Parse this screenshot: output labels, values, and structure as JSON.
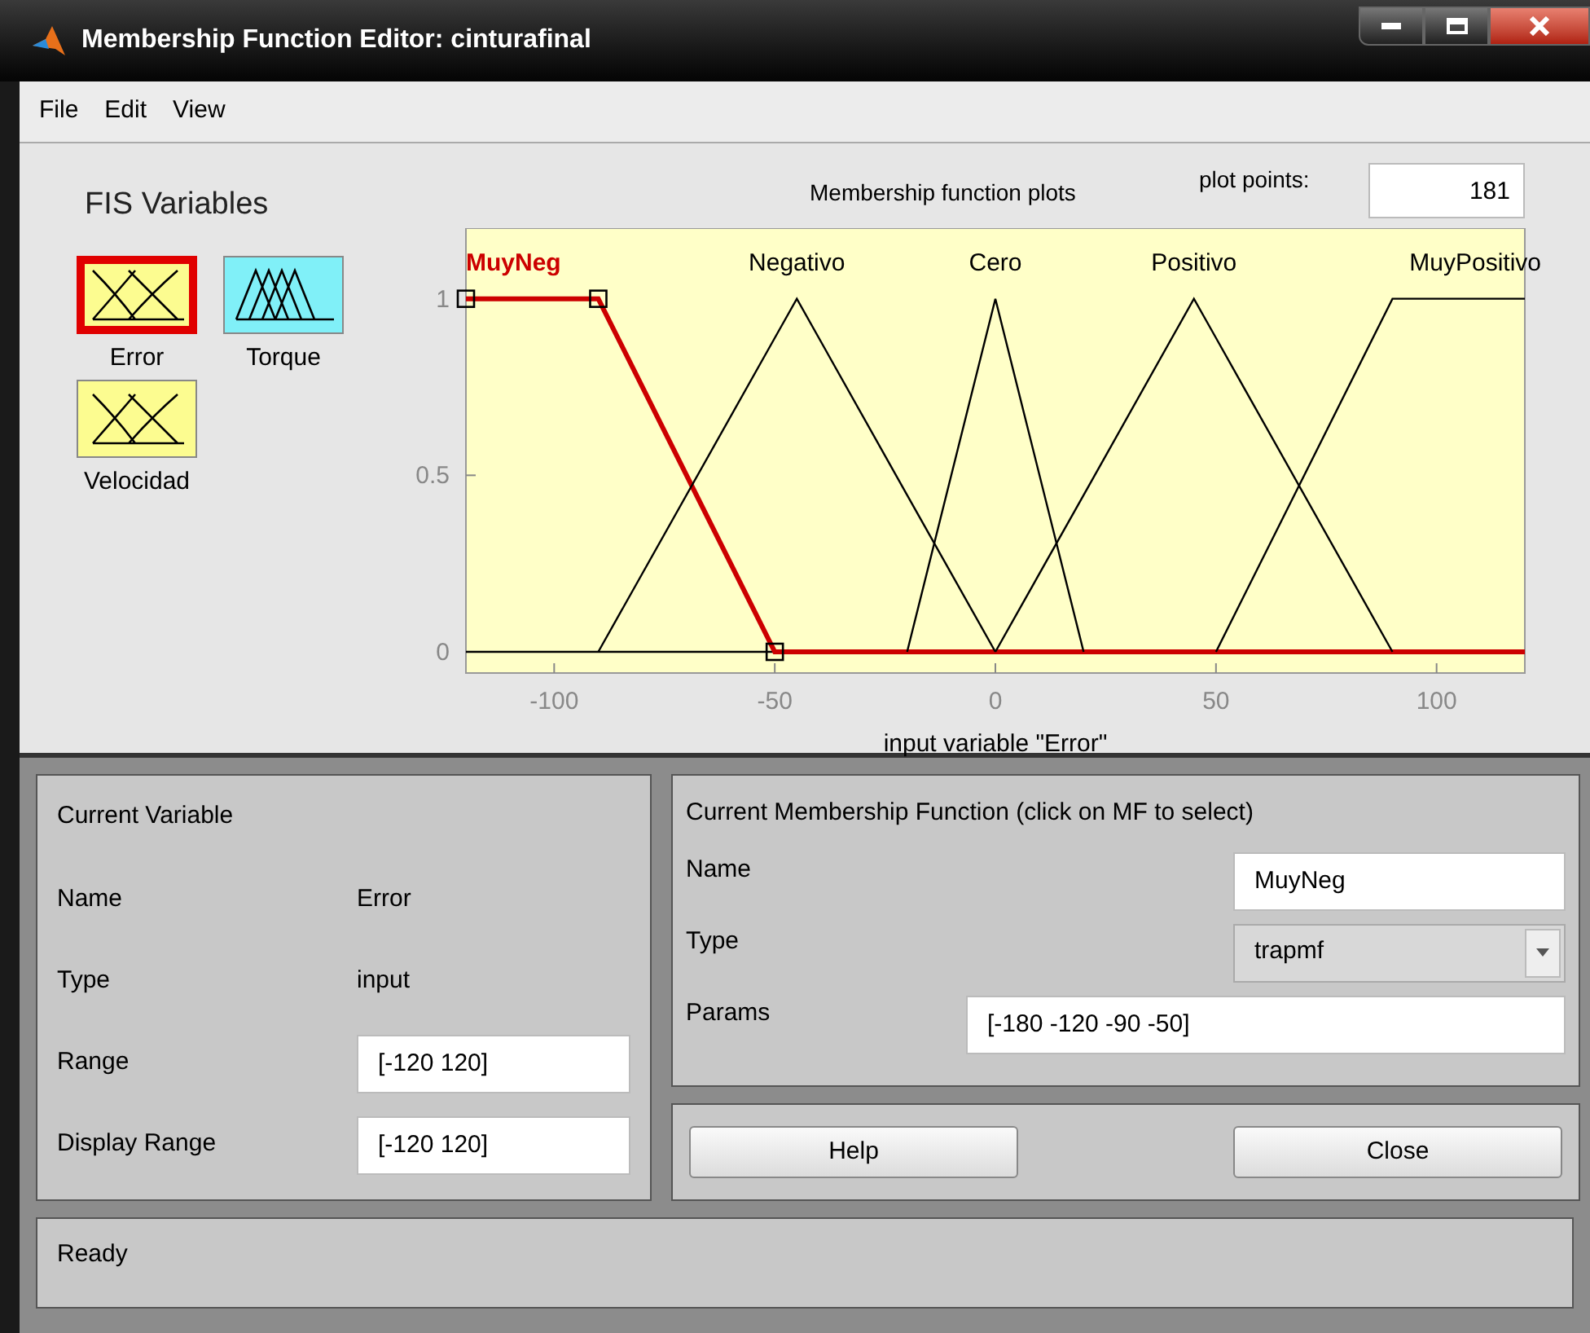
{
  "window": {
    "title": "Membership Function Editor: cinturafinal"
  },
  "menu": [
    "File",
    "Edit",
    "View"
  ],
  "fis_variables": {
    "title": "FIS Variables",
    "items": [
      {
        "label": "Error",
        "kind": "input",
        "selected": true
      },
      {
        "label": "Torque",
        "kind": "output",
        "selected": false
      },
      {
        "label": "Velocidad",
        "kind": "input",
        "selected": false
      }
    ]
  },
  "plot": {
    "title": "Membership function plots",
    "plot_points_label": "plot points:",
    "plot_points": "181",
    "chart_data": {
      "type": "line",
      "xlabel": "input variable \"Error\"",
      "x": [
        -120,
        -90,
        -50,
        -45,
        -20,
        0,
        20,
        45,
        50,
        90,
        120
      ],
      "xlim": [
        -120,
        120
      ],
      "ylim": [
        -0.06,
        1.2
      ],
      "xticks": [
        -100,
        -50,
        0,
        50,
        100
      ],
      "yticks": [
        0,
        0.5,
        1
      ],
      "series": [
        {
          "name": "MuyNeg",
          "color": "#cc0000",
          "values": [
            1,
            1,
            0,
            0,
            0,
            0,
            0,
            0,
            0,
            0,
            0
          ]
        },
        {
          "name": "Negativo",
          "color": "#000000",
          "values": [
            null,
            0,
            0.889,
            1,
            0.444,
            0,
            null,
            null,
            null,
            null,
            null
          ]
        },
        {
          "name": "Cero",
          "color": "#000000",
          "values": [
            null,
            null,
            null,
            null,
            0,
            1,
            0,
            null,
            null,
            null,
            null
          ]
        },
        {
          "name": "Positivo",
          "color": "#000000",
          "values": [
            null,
            null,
            null,
            null,
            null,
            0,
            0.444,
            1,
            0.889,
            0,
            null
          ]
        },
        {
          "name": "MuyPositivo",
          "color": "#000000",
          "values": [
            null,
            null,
            null,
            null,
            null,
            null,
            null,
            null,
            0,
            1,
            1
          ]
        }
      ]
    }
  },
  "current_variable": {
    "title": "Current Variable",
    "rows": [
      {
        "label": "Name",
        "value": "Error",
        "kind": "text"
      },
      {
        "label": "Type",
        "value": "input",
        "kind": "text"
      },
      {
        "label": "Range",
        "value": "[-120 120]",
        "kind": "field"
      },
      {
        "label": "Display Range",
        "value": "[-120 120]",
        "kind": "field"
      }
    ]
  },
  "current_mf": {
    "title": "Current Membership Function (click on MF to select)",
    "name_label": "Name",
    "name": "MuyNeg",
    "type_label": "Type",
    "type": "trapmf",
    "params_label": "Params",
    "params": "[-180 -120 -90 -50]"
  },
  "buttons": [
    "Help",
    "Close"
  ],
  "status": "Ready"
}
